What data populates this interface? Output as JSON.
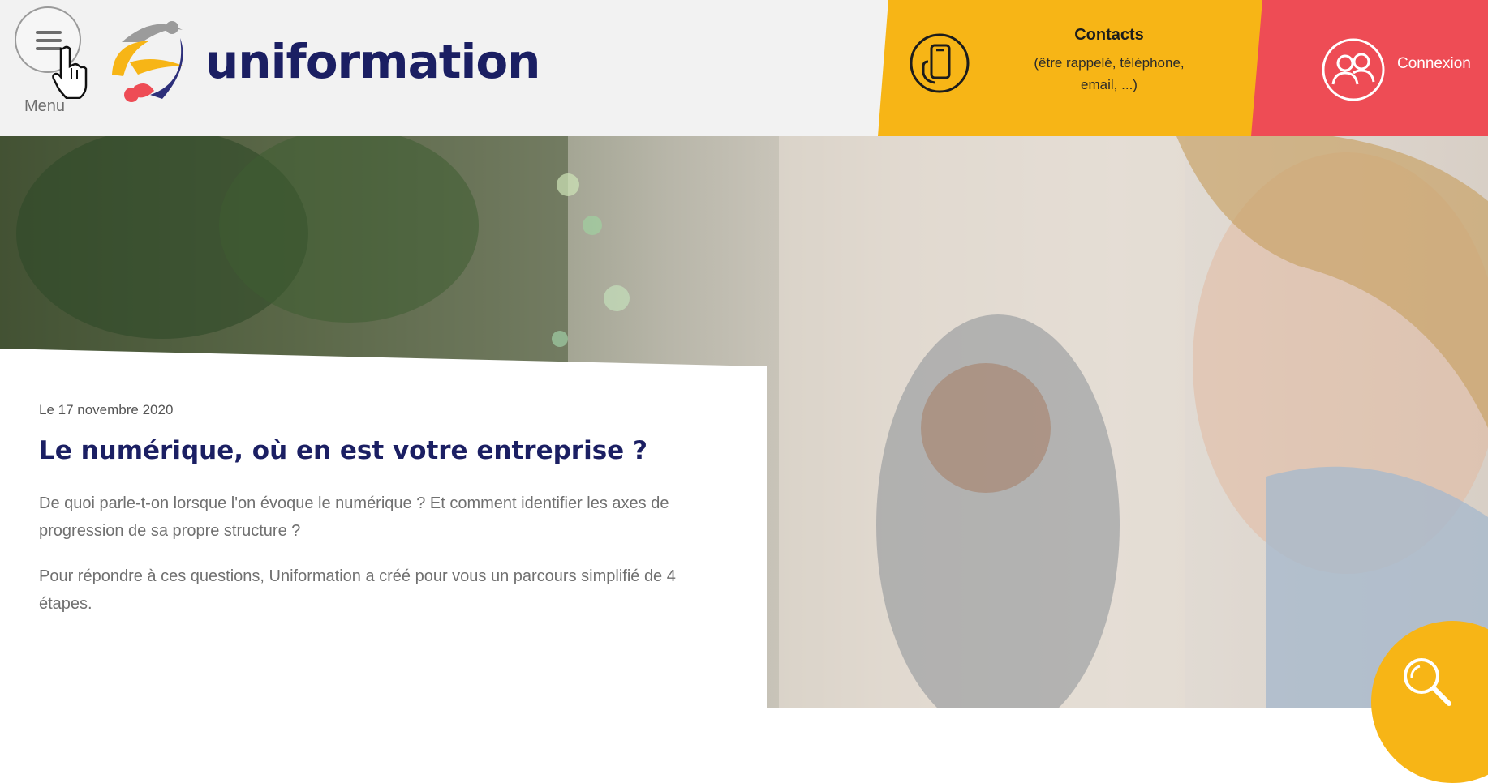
{
  "header": {
    "menu_label": "Menu",
    "brand_name": "uniformation",
    "contacts": {
      "title": "Contacts",
      "subtitle_line1": "(être rappelé, téléphone,",
      "subtitle_line2": "email, ...)"
    },
    "login_label": "Connexion"
  },
  "article": {
    "date": "Le 17 novembre 2020",
    "title": "Le numérique, où en est votre entreprise ?",
    "lead": "De quoi parle-t-on lorsque l'on évoque le numérique ? Et comment identifier les axes de progression de sa propre structure ?",
    "body": "Pour répondre à ces questions, Uniformation a créé pour vous un parcours simplifié de 4 étapes."
  },
  "colors": {
    "brand_navy": "#1b1f63",
    "contacts_yellow": "#f7b516",
    "login_red": "#ee4c55",
    "header_bg": "#f2f2f2"
  },
  "icons": {
    "menu": "hamburger-icon",
    "cursor": "hand-cursor-icon",
    "contacts": "phone-hand-icon",
    "login": "users-icon",
    "search": "search-icon"
  }
}
